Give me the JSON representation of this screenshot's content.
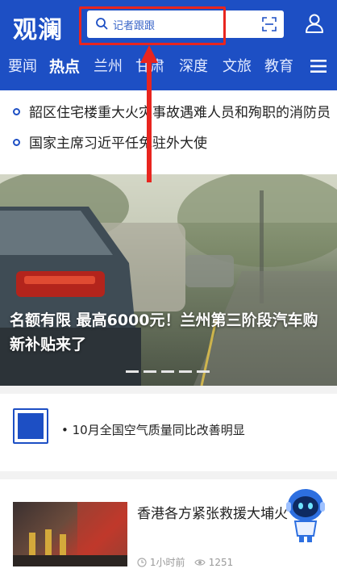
{
  "header": {
    "logo": "观澜",
    "search_placeholder": "记者跟跟",
    "tabs": [
      "要闻",
      "热点",
      "兰州",
      "甘肃",
      "深度",
      "文旅",
      "教育"
    ],
    "active_tab": "热点"
  },
  "news_list": [
    "韶区住宅楼重大火灾事故遇难人员和殉职的消防员",
    "国家主席习近平任免驻外大使"
  ],
  "hero": {
    "title": "名额有限 最高6000元！兰州第三阶段汽车购新补贴来了",
    "slide_count": 5
  },
  "air_quality": {
    "text": "• 10月全国空气质量同比改善明显"
  },
  "story": {
    "title": "香港各方紧张救援大埔火",
    "time": "1小时前",
    "views": "1251"
  },
  "colors": {
    "brand_blue": "#1d4fc4",
    "annotation_red": "#e8251f"
  },
  "icons": {
    "search": "search-icon",
    "scan": "scan-icon",
    "user": "user-icon",
    "menu": "menu-icon",
    "clock": "clock-icon",
    "eye": "eye-icon",
    "assistant": "robot-assistant-icon"
  }
}
